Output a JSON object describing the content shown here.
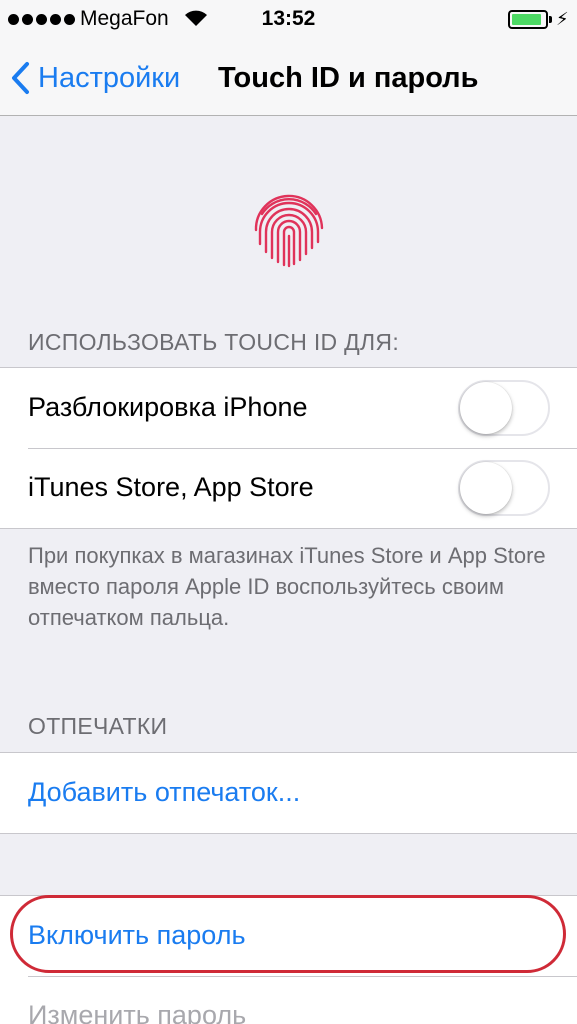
{
  "status_bar": {
    "carrier": "MegaFon",
    "time": "13:52",
    "battery_level": 0.9,
    "battery_color": "#4cd964",
    "icons": [
      "signal-dots-icon",
      "wifi-icon",
      "battery-icon",
      "charging-bolt-icon"
    ]
  },
  "nav": {
    "back_label": "Настройки",
    "title": "Touch ID и пароль",
    "accent_color": "#1a7cf0"
  },
  "fingerprint": {
    "icon": "fingerprint-icon",
    "color": "#e0335a"
  },
  "touch_id": {
    "header": "ИСПОЛЬЗОВАТЬ TOUCH ID ДЛЯ:",
    "rows": [
      {
        "label": "Разблокировка iPhone",
        "enabled": false
      },
      {
        "label": "iTunes Store, App Store",
        "enabled": false
      }
    ],
    "footer": "При покупках в магазинах iTunes Store и App Store вместо пароля Apple ID воспользуйтесь своим отпечатком пальца."
  },
  "fingerprints": {
    "header": "ОТПЕЧАТКИ",
    "add_label": "Добавить отпечаток..."
  },
  "passcode": {
    "enable_label": "Включить пароль",
    "change_label": "Изменить пароль",
    "highlight_color": "#cf2a37"
  }
}
